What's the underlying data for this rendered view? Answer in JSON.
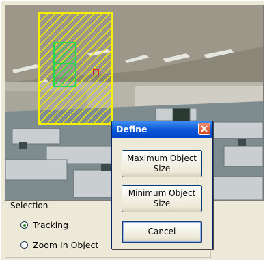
{
  "camera_view": {
    "zone_color": "#f4f000",
    "track_color": "#22d94a",
    "target_color": "#e02020"
  },
  "selection": {
    "legend": "Selection",
    "options": [
      {
        "label": "Tracking",
        "selected": true
      },
      {
        "label": "Zoom In Object",
        "selected": false
      }
    ]
  },
  "dialog": {
    "title": "Define",
    "close_icon": "close-icon",
    "buttons": {
      "max_object_size": "Maximum Object\nSize",
      "min_object_size": "Minimum Object\nSize",
      "cancel": "Cancel"
    },
    "title_color": "#0a56d8",
    "close_color": "#d4441c"
  }
}
